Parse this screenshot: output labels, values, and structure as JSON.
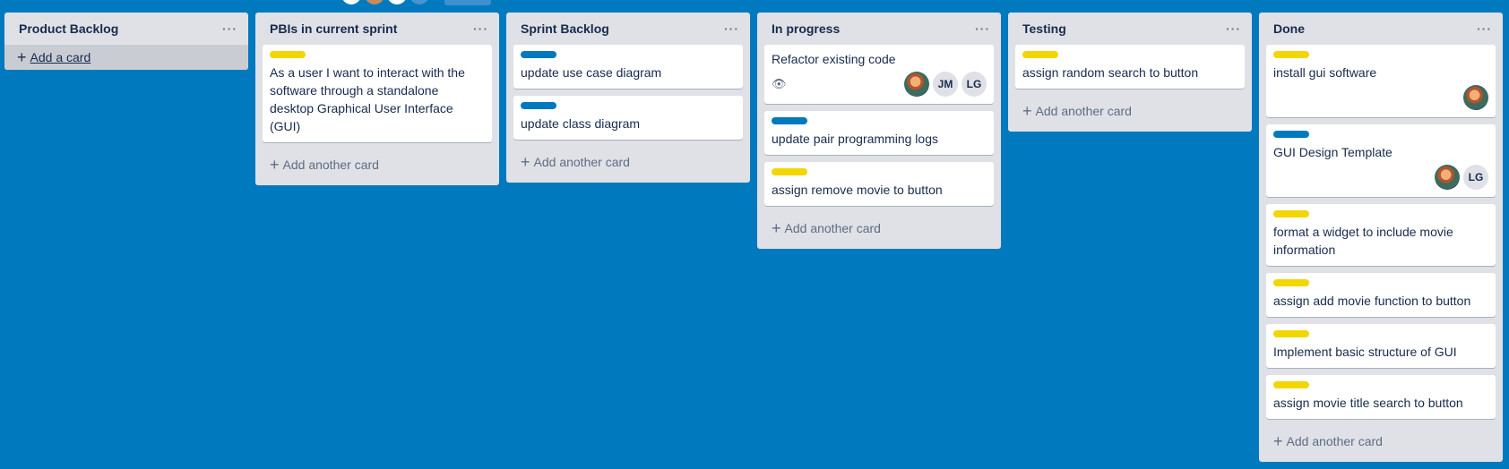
{
  "colors": {
    "background": "#0079bf",
    "label_yellow": "#f2d600",
    "label_blue": "#0079bf"
  },
  "lists": [
    {
      "title": "Product Backlog",
      "add_label": "Add a card",
      "cards": []
    },
    {
      "title": "PBIs in current sprint",
      "add_label": "Add another card",
      "cards": [
        {
          "label": "yellow",
          "title": "As a user I want to interact with the software through a standalone desktop Graphical User Interface (GUI)"
        }
      ]
    },
    {
      "title": "Sprint Backlog",
      "add_label": "Add another card",
      "cards": [
        {
          "label": "blue",
          "title": "update use case diagram"
        },
        {
          "label": "blue",
          "title": "update class diagram"
        }
      ]
    },
    {
      "title": "In progress",
      "add_label": "Add another card",
      "cards": [
        {
          "title": "Refactor existing code",
          "watch_icon": "eye-icon",
          "members": [
            "photo",
            "JM",
            "LG"
          ]
        },
        {
          "label": "blue",
          "title": "update pair programming logs"
        },
        {
          "label": "yellow",
          "title": "assign remove movie to button"
        }
      ]
    },
    {
      "title": "Testing",
      "add_label": "Add another card",
      "cards": [
        {
          "label": "yellow",
          "title": "assign random search to button"
        }
      ]
    },
    {
      "title": "Done",
      "add_label": "Add another card",
      "cards": [
        {
          "label": "yellow",
          "title": "install gui software",
          "members": [
            "photo"
          ]
        },
        {
          "label": "blue",
          "title": "GUI Design Template",
          "members": [
            "photo",
            "LG"
          ]
        },
        {
          "label": "yellow",
          "title": "format a widget to include movie information"
        },
        {
          "label": "yellow",
          "title": "assign add movie function to button"
        },
        {
          "label": "yellow",
          "title": "Implement basic structure of GUI"
        },
        {
          "label": "yellow",
          "title": "assign movie title search to button"
        }
      ]
    }
  ],
  "list_menu_icon": "more-horizontal-icon"
}
